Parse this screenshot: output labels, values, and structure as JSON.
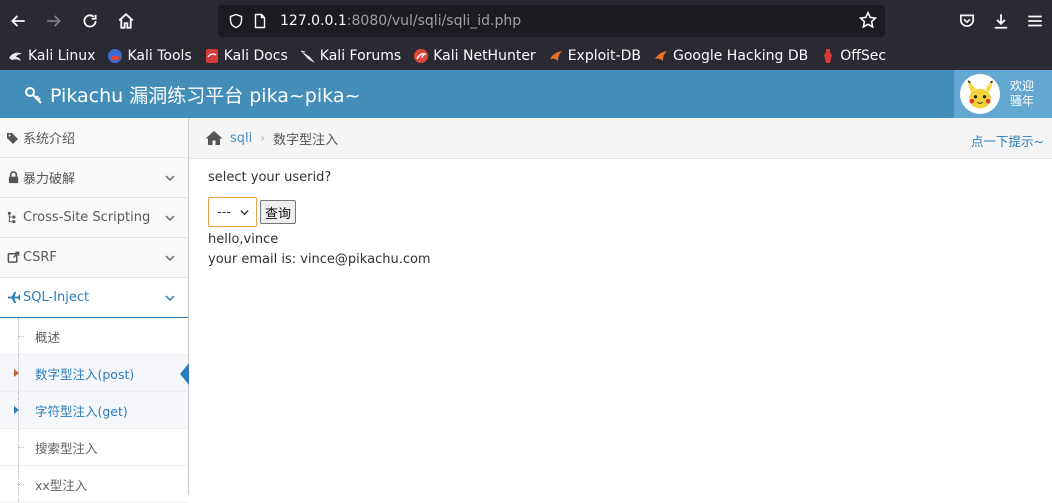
{
  "browser": {
    "url_host": "127.0.0.1",
    "url_rest": ":8080/vul/sqli/sqli_id.php",
    "bookmarks": [
      {
        "label": "Kali Linux",
        "icon": "kali-icon"
      },
      {
        "label": "Kali Tools",
        "icon": "kali-tools-icon"
      },
      {
        "label": "Kali Docs",
        "icon": "kali-docs-icon"
      },
      {
        "label": "Kali Forums",
        "icon": "kali-forums-icon"
      },
      {
        "label": "Kali NetHunter",
        "icon": "nethunter-icon"
      },
      {
        "label": "Exploit-DB",
        "icon": "exploitdb-icon"
      },
      {
        "label": "Google Hacking DB",
        "icon": "ghdb-icon"
      },
      {
        "label": "OffSec",
        "icon": "offsec-icon"
      }
    ]
  },
  "header": {
    "title": "Pikachu 漏洞练习平台 pika~pika~",
    "welcome_line1": "欢迎",
    "welcome_line2": "骚年",
    "bg_color": "#438eb9"
  },
  "sidebar": {
    "items": [
      {
        "label": "系统介绍",
        "icon": "tags-icon"
      },
      {
        "label": "暴力破解",
        "icon": "lock-icon"
      },
      {
        "label": "Cross-Site Scripting",
        "icon": "sitemap-icon"
      },
      {
        "label": "CSRF",
        "icon": "share-icon"
      },
      {
        "label": "SQL-Inject",
        "icon": "plane-icon"
      }
    ],
    "sub_items": [
      {
        "label": "概述"
      },
      {
        "label": "数字型注入(post)"
      },
      {
        "label": "字符型注入(get)"
      },
      {
        "label": "搜索型注入"
      },
      {
        "label": "xx型注入"
      }
    ]
  },
  "breadcrumb": {
    "parent": "sqli",
    "current": "数字型注入",
    "hint": "点一下提示~"
  },
  "main": {
    "prompt": "select your userid?",
    "select_value": "---",
    "submit_label": "查询",
    "result_line1": "hello,vince",
    "result_line2": "your email is: vince@pikachu.com"
  }
}
